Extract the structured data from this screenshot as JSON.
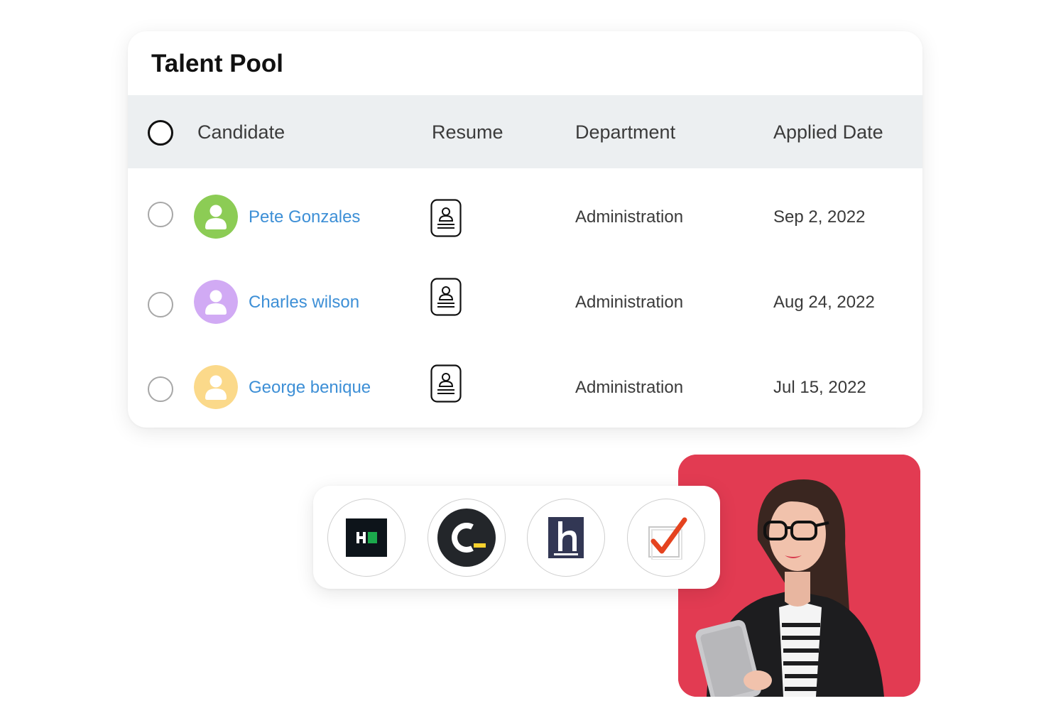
{
  "card": {
    "title": "Talent Pool",
    "columns": {
      "candidate": "Candidate",
      "resume": "Resume",
      "department": "Department",
      "applied_date": "Applied Date"
    },
    "rows": [
      {
        "name": "Pete Gonzales",
        "department": "Administration",
        "date": "Sep 2, 2022",
        "avatar_color": "#8ccc55"
      },
      {
        "name": "Charles wilson",
        "department": "Administration",
        "date": "Aug 24, 2022",
        "avatar_color": "#d1aaf4"
      },
      {
        "name": "George benique",
        "department": "Administration",
        "date": "Jul 15, 2022",
        "avatar_color": "#fbd98a"
      }
    ]
  },
  "integrations": [
    {
      "icon": "hackerrank-logo-icon"
    },
    {
      "icon": "codility-logo-icon"
    },
    {
      "icon": "hackerearth-logo-icon"
    },
    {
      "icon": "testgorilla-checkmark-logo-icon"
    }
  ],
  "colors": {
    "link_blue": "#3d8fd6",
    "header_bg": "#eceff1",
    "photo_bg": "#e23b52"
  }
}
